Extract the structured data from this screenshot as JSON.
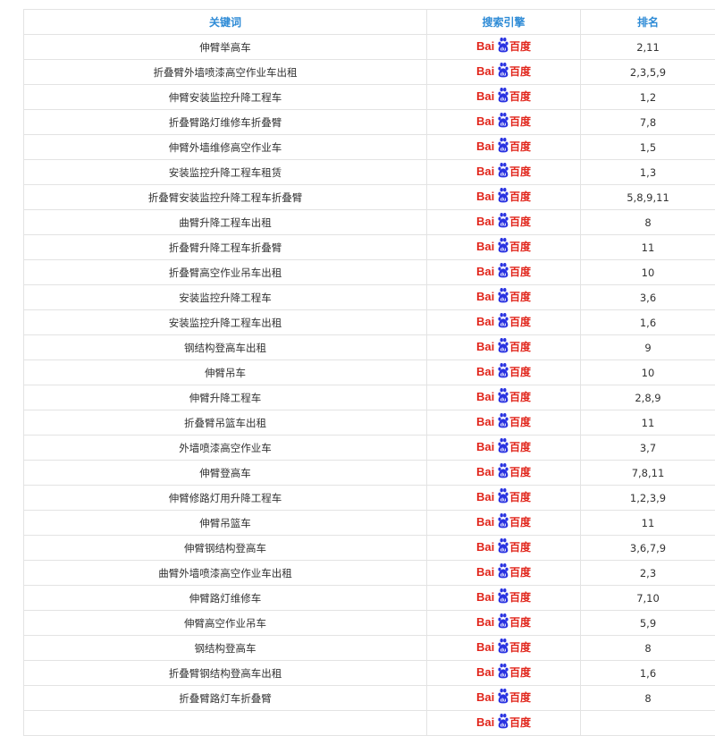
{
  "table": {
    "headers": [
      "关键词",
      "搜索引擎",
      "排名"
    ],
    "rows": [
      {
        "keyword": "伸臂举高车",
        "engine": "Baidu百度",
        "rank": "2,11"
      },
      {
        "keyword": "折叠臂外墙喷漆高空作业车出租",
        "engine": "Baidu百度",
        "rank": "2,3,5,9"
      },
      {
        "keyword": "伸臂安装监控升降工程车",
        "engine": "Baidu百度",
        "rank": "1,2"
      },
      {
        "keyword": "折叠臂路灯维修车折叠臂",
        "engine": "Baidu百度",
        "rank": "7,8"
      },
      {
        "keyword": "伸臂外墙维修高空作业车",
        "engine": "Baidu百度",
        "rank": "1,5"
      },
      {
        "keyword": "安装监控升降工程车租赁",
        "engine": "Baidu百度",
        "rank": "1,3"
      },
      {
        "keyword": "折叠臂安装监控升降工程车折叠臂",
        "engine": "Baidu百度",
        "rank": "5,8,9,11"
      },
      {
        "keyword": "曲臂升降工程车出租",
        "engine": "Baidu百度",
        "rank": "8"
      },
      {
        "keyword": "折叠臂升降工程车折叠臂",
        "engine": "Baidu百度",
        "rank": "11"
      },
      {
        "keyword": "折叠臂高空作业吊车出租",
        "engine": "Baidu百度",
        "rank": "10"
      },
      {
        "keyword": "安装监控升降工程车",
        "engine": "Baidu百度",
        "rank": "3,6"
      },
      {
        "keyword": "安装监控升降工程车出租",
        "engine": "Baidu百度",
        "rank": "1,6"
      },
      {
        "keyword": "钢结构登高车出租",
        "engine": "Baidu百度",
        "rank": "9"
      },
      {
        "keyword": "伸臂吊车",
        "engine": "Baidu百度",
        "rank": "10"
      },
      {
        "keyword": "伸臂升降工程车",
        "engine": "Baidu百度",
        "rank": "2,8,9"
      },
      {
        "keyword": "折叠臂吊篮车出租",
        "engine": "Baidu百度",
        "rank": "11"
      },
      {
        "keyword": "外墙喷漆高空作业车",
        "engine": "Baidu百度",
        "rank": "3,7"
      },
      {
        "keyword": "伸臂登高车",
        "engine": "Baidu百度",
        "rank": "7,8,11"
      },
      {
        "keyword": "伸臂修路灯用升降工程车",
        "engine": "Baidu百度",
        "rank": "1,2,3,9"
      },
      {
        "keyword": "伸臂吊篮车",
        "engine": "Baidu百度",
        "rank": "11"
      },
      {
        "keyword": "伸臂钢结构登高车",
        "engine": "Baidu百度",
        "rank": "3,6,7,9"
      },
      {
        "keyword": "曲臂外墙喷漆高空作业车出租",
        "engine": "Baidu百度",
        "rank": "2,3"
      },
      {
        "keyword": "伸臂路灯维修车",
        "engine": "Baidu百度",
        "rank": "7,10"
      },
      {
        "keyword": "伸臂高空作业吊车",
        "engine": "Baidu百度",
        "rank": "5,9"
      },
      {
        "keyword": "钢结构登高车",
        "engine": "Baidu百度",
        "rank": "8"
      },
      {
        "keyword": "折叠臂钢结构登高车出租",
        "engine": "Baidu百度",
        "rank": "1,6"
      },
      {
        "keyword": "折叠臂路灯车折叠臂",
        "engine": "Baidu百度",
        "rank": "8"
      },
      {
        "keyword": "",
        "engine": "Baidu百度",
        "rank": ""
      }
    ]
  },
  "colors": {
    "header_text": "#2e8bd6",
    "border": "#e3e3e3",
    "body_text": "#333333",
    "baidu_red": "#e1251b",
    "baidu_blue": "#2932e1"
  },
  "icons": {
    "engine_logo": "baidu-logo-icon"
  }
}
